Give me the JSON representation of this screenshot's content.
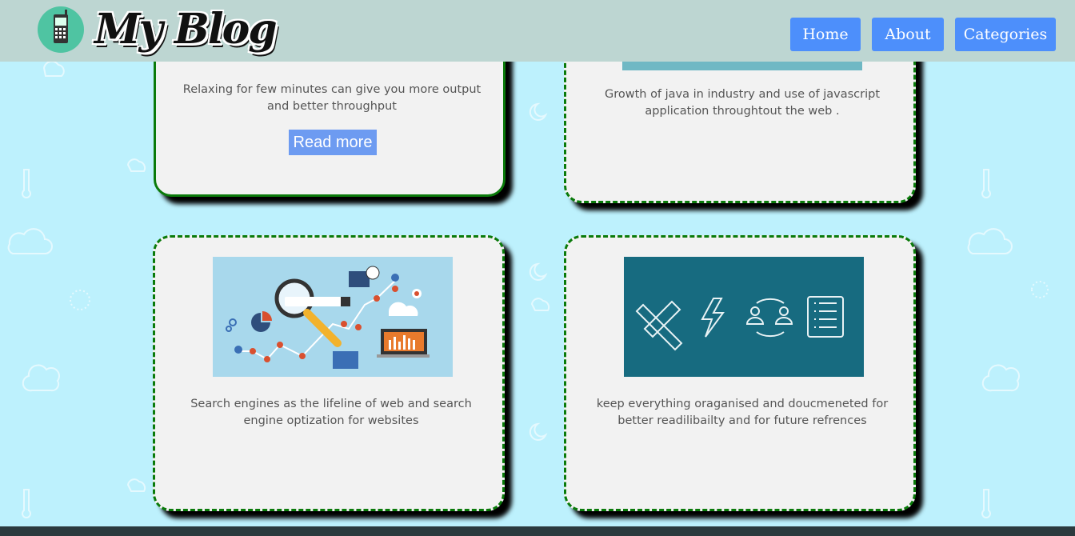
{
  "header": {
    "logo_text": "My Blog",
    "logo_icon": "mobile-phone-icon",
    "nav": [
      {
        "label": "Home"
      },
      {
        "label": "About"
      },
      {
        "label": "Categories"
      }
    ]
  },
  "cards": [
    {
      "description": "Relaxing for few minutes can give you more output and better throughput",
      "button": "Read more"
    },
    {
      "description": "Growth of java in industry and use of javascript application throughtout the web ."
    },
    {
      "description": "Search engines as the lifeline of web and search engine optization for websites",
      "image": "seo-illustration"
    },
    {
      "description": "keep everything oraganised and doucmeneted for better readilibailty and for future refrences",
      "image": "documentation-icons"
    }
  ],
  "colors": {
    "background": "#bdf1fd",
    "header": "#bdd6d2",
    "nav_button": "#4d8ffb",
    "card_border": "#0a7a0a",
    "card_bg": "#f2f2f2"
  }
}
